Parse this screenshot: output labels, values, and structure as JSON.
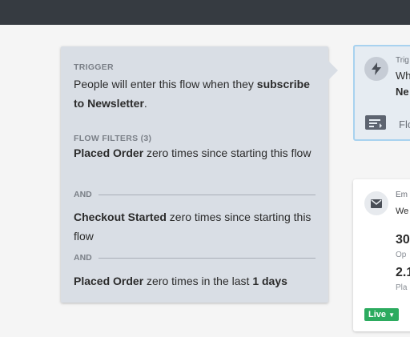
{
  "trigger_tooltip": {
    "trigger_heading": "TRIGGER",
    "trigger_text_before": "People will enter this flow when they ",
    "trigger_text_bold": "subscribe to Newsletter",
    "trigger_text_after": ".",
    "filters_heading": "FLOW FILTERS (3)",
    "filters": [
      {
        "bold": "Placed Order",
        "rest": " zero times since starting this flow"
      },
      {
        "bold": "Checkout Started",
        "rest": " zero times since starting this flow"
      },
      {
        "bold": "Placed Order",
        "rest": " zero times in the last ",
        "bold_end": "1 days"
      }
    ],
    "and_label": "AND"
  },
  "trigger_card": {
    "title_partial": "Trig",
    "line1_partial": "Wh",
    "line2_partial": "Ne",
    "filters_partial": "Flo"
  },
  "email_card": {
    "title_partial": "Em",
    "subtitle_partial": "We",
    "stat1_value": "30",
    "stat1_label": "Op",
    "stat2_value": "2.1",
    "stat2_label": "Pla",
    "status_badge": "Live"
  }
}
